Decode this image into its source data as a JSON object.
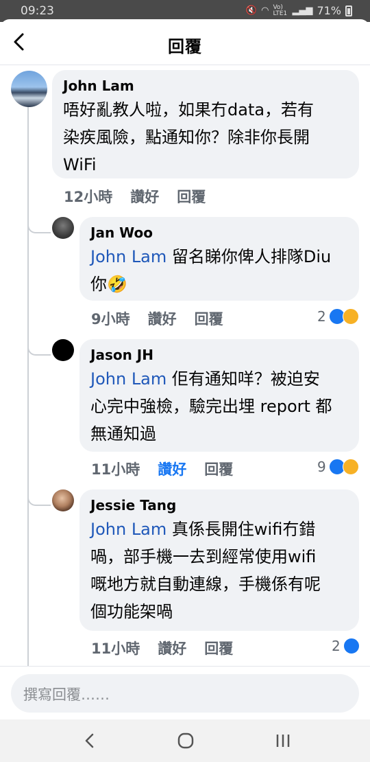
{
  "status_bar": {
    "time": "09:23",
    "network": "Vo) LTE1",
    "battery": "71%"
  },
  "header": {
    "title": "回覆"
  },
  "comments": [
    {
      "author": "John Lam",
      "mention": "",
      "text_lines": [
        "唔好亂教人啦，如果冇data，若有",
        "染疾風險，點通知你？除非你長開",
        "WiFi"
      ],
      "time": "12小時",
      "like": "讚好",
      "reply": "回覆",
      "reaction_count": ""
    },
    {
      "author": "Jan Woo",
      "mention": "John Lam",
      "text_lines": [
        " 留名睇你俾人排隊Diu",
        "你🤣"
      ],
      "time": "9小時",
      "like": "讚好",
      "reply": "回覆",
      "reaction_count": "2"
    },
    {
      "author": "Jason JH",
      "mention": "John Lam",
      "text_lines": [
        " 佢有通知咩？被迫安",
        "心完中強檢，驗完出埋 report 都",
        "無通知過"
      ],
      "time": "11小時",
      "like": "讚好",
      "reply": "回覆",
      "reaction_count": "9"
    },
    {
      "author": "Jessie Tang",
      "mention": "John Lam",
      "text_lines": [
        " 真係長開住wifi冇錯",
        "喎，部手機一去到經常使用wifi",
        "嘅地方就自動連線，手機係有呢",
        "個功能架喎"
      ],
      "time": "11小時",
      "like": "讚好",
      "reply": "回覆",
      "reaction_count": "2"
    }
  ],
  "composer": {
    "placeholder": "撰寫回覆……"
  },
  "colors": {
    "accent": "#1877f2",
    "mention": "#1f58b9",
    "bubble": "#f0f2f5"
  }
}
